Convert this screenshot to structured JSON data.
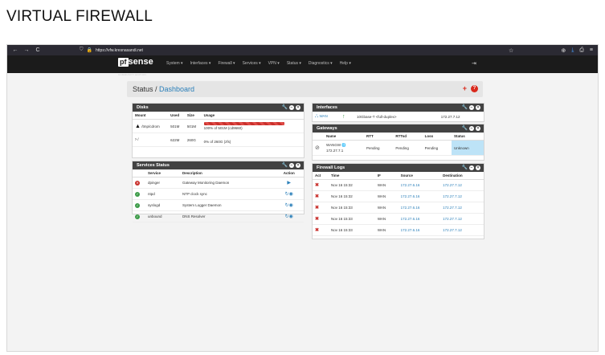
{
  "heading": "VIRTUAL FIREWALL",
  "browser": {
    "nav_back": "←",
    "nav_forward": "→",
    "nav_reload": "C",
    "url": "https://vfw.kresnasandi.net",
    "star": "☆",
    "toolbar_icons": [
      "⊕",
      "⤓",
      "⎙",
      "≡"
    ]
  },
  "navbar": {
    "logo_mark": "pf",
    "logo_word": "sense",
    "logo_sub": "COMMUNITY EDITION",
    "menu": [
      "System ▾",
      "Interfaces ▾",
      "Firewall ▾",
      "Services ▾",
      "VPN ▾",
      "Status ▾",
      "Diagnostics ▾",
      "Help ▾"
    ],
    "logout_icon": "⇥"
  },
  "breadcrumb": {
    "section": "Status /",
    "page": "Dashboard",
    "add": "+",
    "help": "?"
  },
  "disks": {
    "title": "Disks",
    "columns": [
      "Mount",
      "Used",
      "Size",
      "Usage"
    ],
    "rows": [
      {
        "mount": "/tmp/cdrom",
        "used": "501M",
        "size": "501M",
        "usage": "100% of 501M (cd9660)"
      },
      {
        "mount": "/",
        "used": "622M",
        "size": "260G",
        "usage": "0% of 260G (zfs)"
      }
    ]
  },
  "services": {
    "title": "Services Status",
    "columns": [
      "",
      "Service",
      "Description",
      "Action"
    ],
    "rows": [
      {
        "status": "stopped",
        "service": "dpinger",
        "description": "Gateway Monitoring Daemon"
      },
      {
        "status": "running",
        "service": "ntpd",
        "description": "NTP clock sync"
      },
      {
        "status": "running",
        "service": "syslogd",
        "description": "System Logger Daemon"
      },
      {
        "status": "running",
        "service": "unbound",
        "description": "DNS Resolver"
      }
    ]
  },
  "interfaces": {
    "title": "Interfaces",
    "rows": [
      {
        "name": "WAN",
        "media": "10Gbase-T <full-duplex>",
        "ip": "172.27.7.12"
      }
    ]
  },
  "gateways": {
    "title": "Gateways",
    "columns": [
      "",
      "Name",
      "RTT",
      "RTTsd",
      "Loss",
      "Status"
    ],
    "rows": [
      {
        "name": "WANGW",
        "ip": "172.27.7.1",
        "rtt": "Pending",
        "rttsd": "Pending",
        "loss": "Pending",
        "status": "Unknown"
      }
    ]
  },
  "firewall_logs": {
    "title": "Firewall Logs",
    "columns": [
      "Act",
      "Time",
      "IF",
      "Source",
      "Destination"
    ],
    "rows": [
      {
        "time": "Nov 16 15:32",
        "if": "WAN",
        "source": "172.27.6.16",
        "destination": "172.27.7.12"
      },
      {
        "time": "Nov 16 15:32",
        "if": "WAN",
        "source": "172.27.6.16",
        "destination": "172.27.7.12"
      },
      {
        "time": "Nov 16 15:33",
        "if": "WAN",
        "source": "172.27.6.16",
        "destination": "172.27.7.12"
      },
      {
        "time": "Nov 16 15:33",
        "if": "WAN",
        "source": "172.27.6.16",
        "destination": "172.27.7.12"
      },
      {
        "time": "Nov 16 15:33",
        "if": "WAN",
        "source": "172.27.6.16",
        "destination": "172.27.7.12"
      }
    ]
  }
}
